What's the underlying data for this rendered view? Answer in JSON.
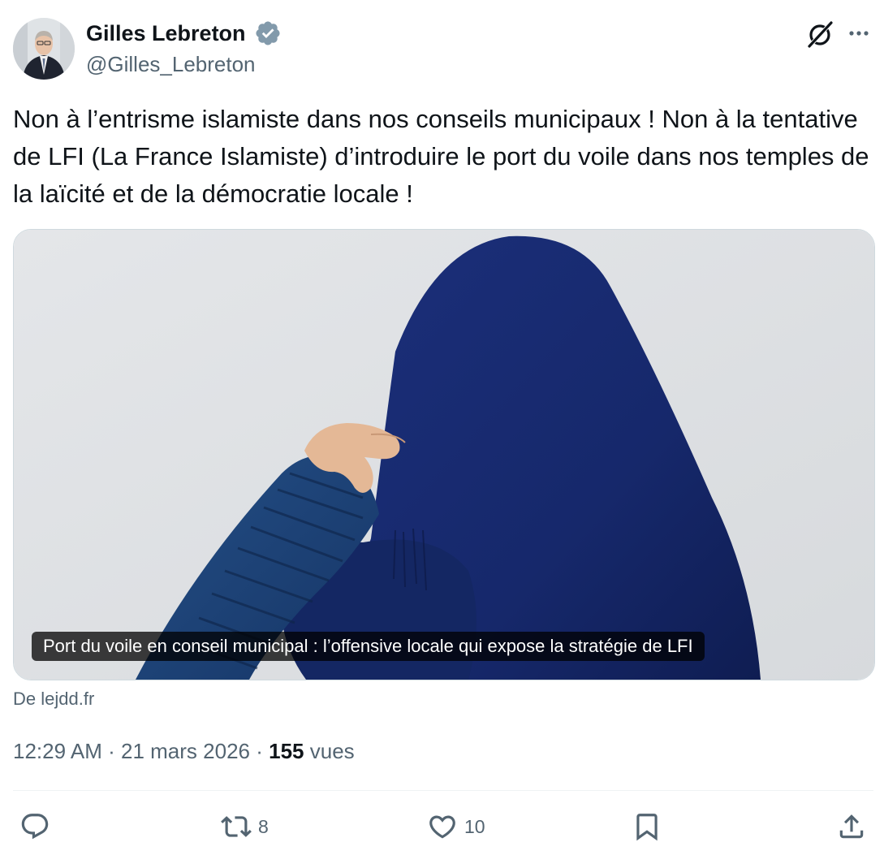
{
  "author": {
    "name": "Gilles Lebreton",
    "handle": "@Gilles_Lebreton",
    "verified": true,
    "avatar_icon": "avatar-photo"
  },
  "tweet": {
    "text": "Non à l’entrisme islamiste dans nos conseils municipaux ! Non à la tentative de LFI (La France Islamiste) d’introduire le port du voile dans nos temples de la laïcité et de la démocratie locale !"
  },
  "link_card": {
    "caption": "Port du voile en conseil municipal : l’offensive locale qui expose la stratégie de LFI",
    "source": "De lejdd.fr"
  },
  "meta": {
    "time": "12:29 AM",
    "separator": "·",
    "date": "21 mars 2026",
    "views_count": "155",
    "views_label": "vues"
  },
  "actions": {
    "reply": {
      "icon": "reply-icon",
      "count": ""
    },
    "repost": {
      "icon": "repost-icon",
      "count": "8"
    },
    "like": {
      "icon": "heart-icon",
      "count": "10"
    },
    "bookmark": {
      "icon": "bookmark-icon",
      "count": ""
    },
    "share": {
      "icon": "share-icon",
      "count": ""
    }
  },
  "colors": {
    "text_primary": "#0f1419",
    "text_secondary": "#536471",
    "verified_badge": "#829aab",
    "border": "#cfd9de",
    "veil_blue": "#15276a"
  }
}
